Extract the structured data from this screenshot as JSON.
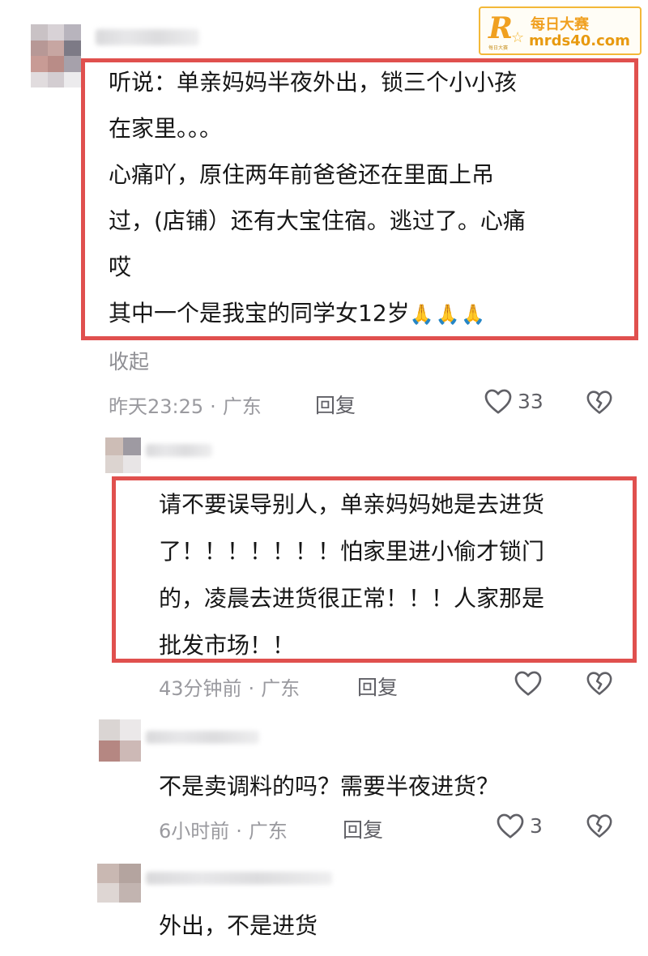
{
  "watermark": {
    "title": "每日大赛",
    "url": "mrds40.com",
    "tiny": "每日大赛",
    "logo_letter": "R",
    "accent": "#f0a020"
  },
  "comments": [
    {
      "text": "听说：单亲妈妈半夜外出，锁三个小小孩\n在家里。。。\n心痛吖，原住两年前爸爸还在里面上吊\n过，(店铺）还有大宝住宿。逃过了。心痛\n哎\n其中一个是我宝的同学女12岁",
      "emoji": "🙏🙏🙏",
      "collapse_label": "收起",
      "time": "昨天23:25",
      "location": "广东",
      "reply_label": "回复",
      "likes": "33",
      "highlighted": true
    },
    {
      "text": "请不要误导别人，单亲妈妈她是去进货\n了！！！！！！！怕家里进小偷才锁门\n的，凌晨去进货很正常！！！人家那是\n批发市场！！",
      "time": "43分钟前",
      "location": "广东",
      "reply_label": "回复",
      "likes": "",
      "highlighted": true
    },
    {
      "text": "不是卖调料的吗？需要半夜进货？",
      "time": "6小时前",
      "location": "广东",
      "reply_label": "回复",
      "likes": "3",
      "highlighted": false
    },
    {
      "text": "外出，不是进货",
      "highlighted": false
    }
  ],
  "meta_separator": "·",
  "colors": {
    "highlight_border": "#e0504e",
    "meta_text": "#9a9a9f",
    "body_text": "#161616"
  },
  "icons": {
    "like": "heart-outline-icon",
    "dislike": "broken-heart-icon"
  }
}
